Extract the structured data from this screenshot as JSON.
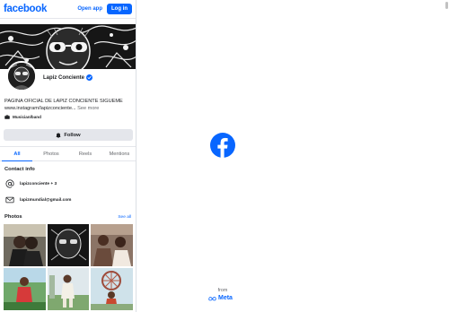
{
  "header": {
    "logo": "facebook",
    "open_app": "Open app",
    "login": "Log in"
  },
  "profile": {
    "name": "Lapiz Conciente",
    "bio_line1": "PAGINA OFICIAL DE LAPIZ CONCIENTE SIGUEME",
    "bio_line2": "www.instagram/lapizconciente...",
    "see_more": "See more",
    "category": "Musician/band",
    "follow": "Follow"
  },
  "tabs": [
    {
      "label": "All",
      "active": true
    },
    {
      "label": "Photos",
      "active": false
    },
    {
      "label": "Reels",
      "active": false
    },
    {
      "label": "Mentions",
      "active": false
    }
  ],
  "contact": {
    "title": "Contact info",
    "threads": "lapizconciente + 3",
    "email": "lapizmundial@gmail.com"
  },
  "photos": {
    "title": "Photos",
    "see_all": "See all"
  },
  "splash": {
    "from": "from",
    "meta": "Meta"
  },
  "colors": {
    "brand": "#0866ff",
    "tab_inactive": "#65676b",
    "button_bg": "#e4e6eb"
  },
  "icons": {
    "verified": "verified-badge-icon",
    "category": "briefcase-icon",
    "follow": "follow-icon",
    "threads": "at-sign-icon",
    "email": "envelope-icon",
    "splash": "facebook-logo-icon",
    "meta": "meta-infinity-icon"
  }
}
